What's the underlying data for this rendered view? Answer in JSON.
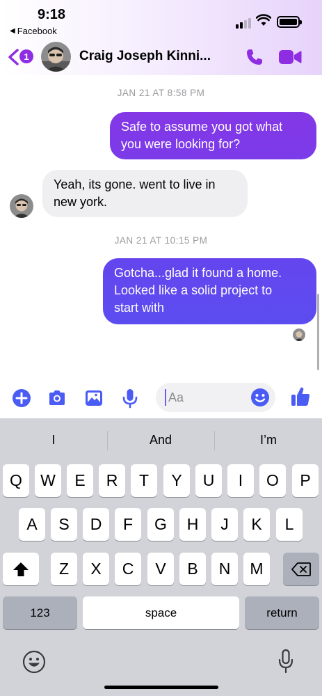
{
  "status_bar": {
    "time": "9:18",
    "back_app_label": "Facebook",
    "back_app_arrow": "◀"
  },
  "header": {
    "unread_count": "1",
    "contact_name": "Craig Joseph Kinni...",
    "icons": [
      "back-chevron-icon",
      "phone-icon",
      "video-camera-icon"
    ]
  },
  "colors": {
    "accent": "#8e2de2",
    "bubble_out_top": "#8437e6",
    "bubble_out_bottom": "#5b4df0",
    "bubble_in": "#efeff1",
    "composer_icon": "#4a5cf4"
  },
  "conversation": {
    "timestamps": [
      "JAN 21 AT 8:58 PM",
      "JAN 21 AT 10:15 PM"
    ],
    "messages": [
      {
        "direction": "outgoing",
        "lines": [
          "Safe to assume you got what",
          "you were looking for?"
        ]
      },
      {
        "direction": "incoming",
        "lines": [
          "Yeah, its gone. went to live in",
          "new york."
        ]
      },
      {
        "direction": "outgoing",
        "lines": [
          "Gotcha...glad it found a home.",
          "Looked like a solid project to",
          "start with"
        ]
      }
    ]
  },
  "composer": {
    "placeholder": "Aa",
    "icons": [
      "plus-icon",
      "camera-icon",
      "image-icon",
      "microphone-icon",
      "emoji-icon",
      "thumbs-up-icon"
    ]
  },
  "keyboard": {
    "suggestions": [
      "I",
      "And",
      "I’m"
    ],
    "row1": [
      "Q",
      "W",
      "E",
      "R",
      "T",
      "Y",
      "U",
      "I",
      "O",
      "P"
    ],
    "row2": [
      "A",
      "S",
      "D",
      "F",
      "G",
      "H",
      "J",
      "K",
      "L"
    ],
    "row3": [
      "Z",
      "X",
      "C",
      "V",
      "B",
      "N",
      "M"
    ],
    "numbers_label": "123",
    "space_label": "space",
    "return_label": "return"
  }
}
